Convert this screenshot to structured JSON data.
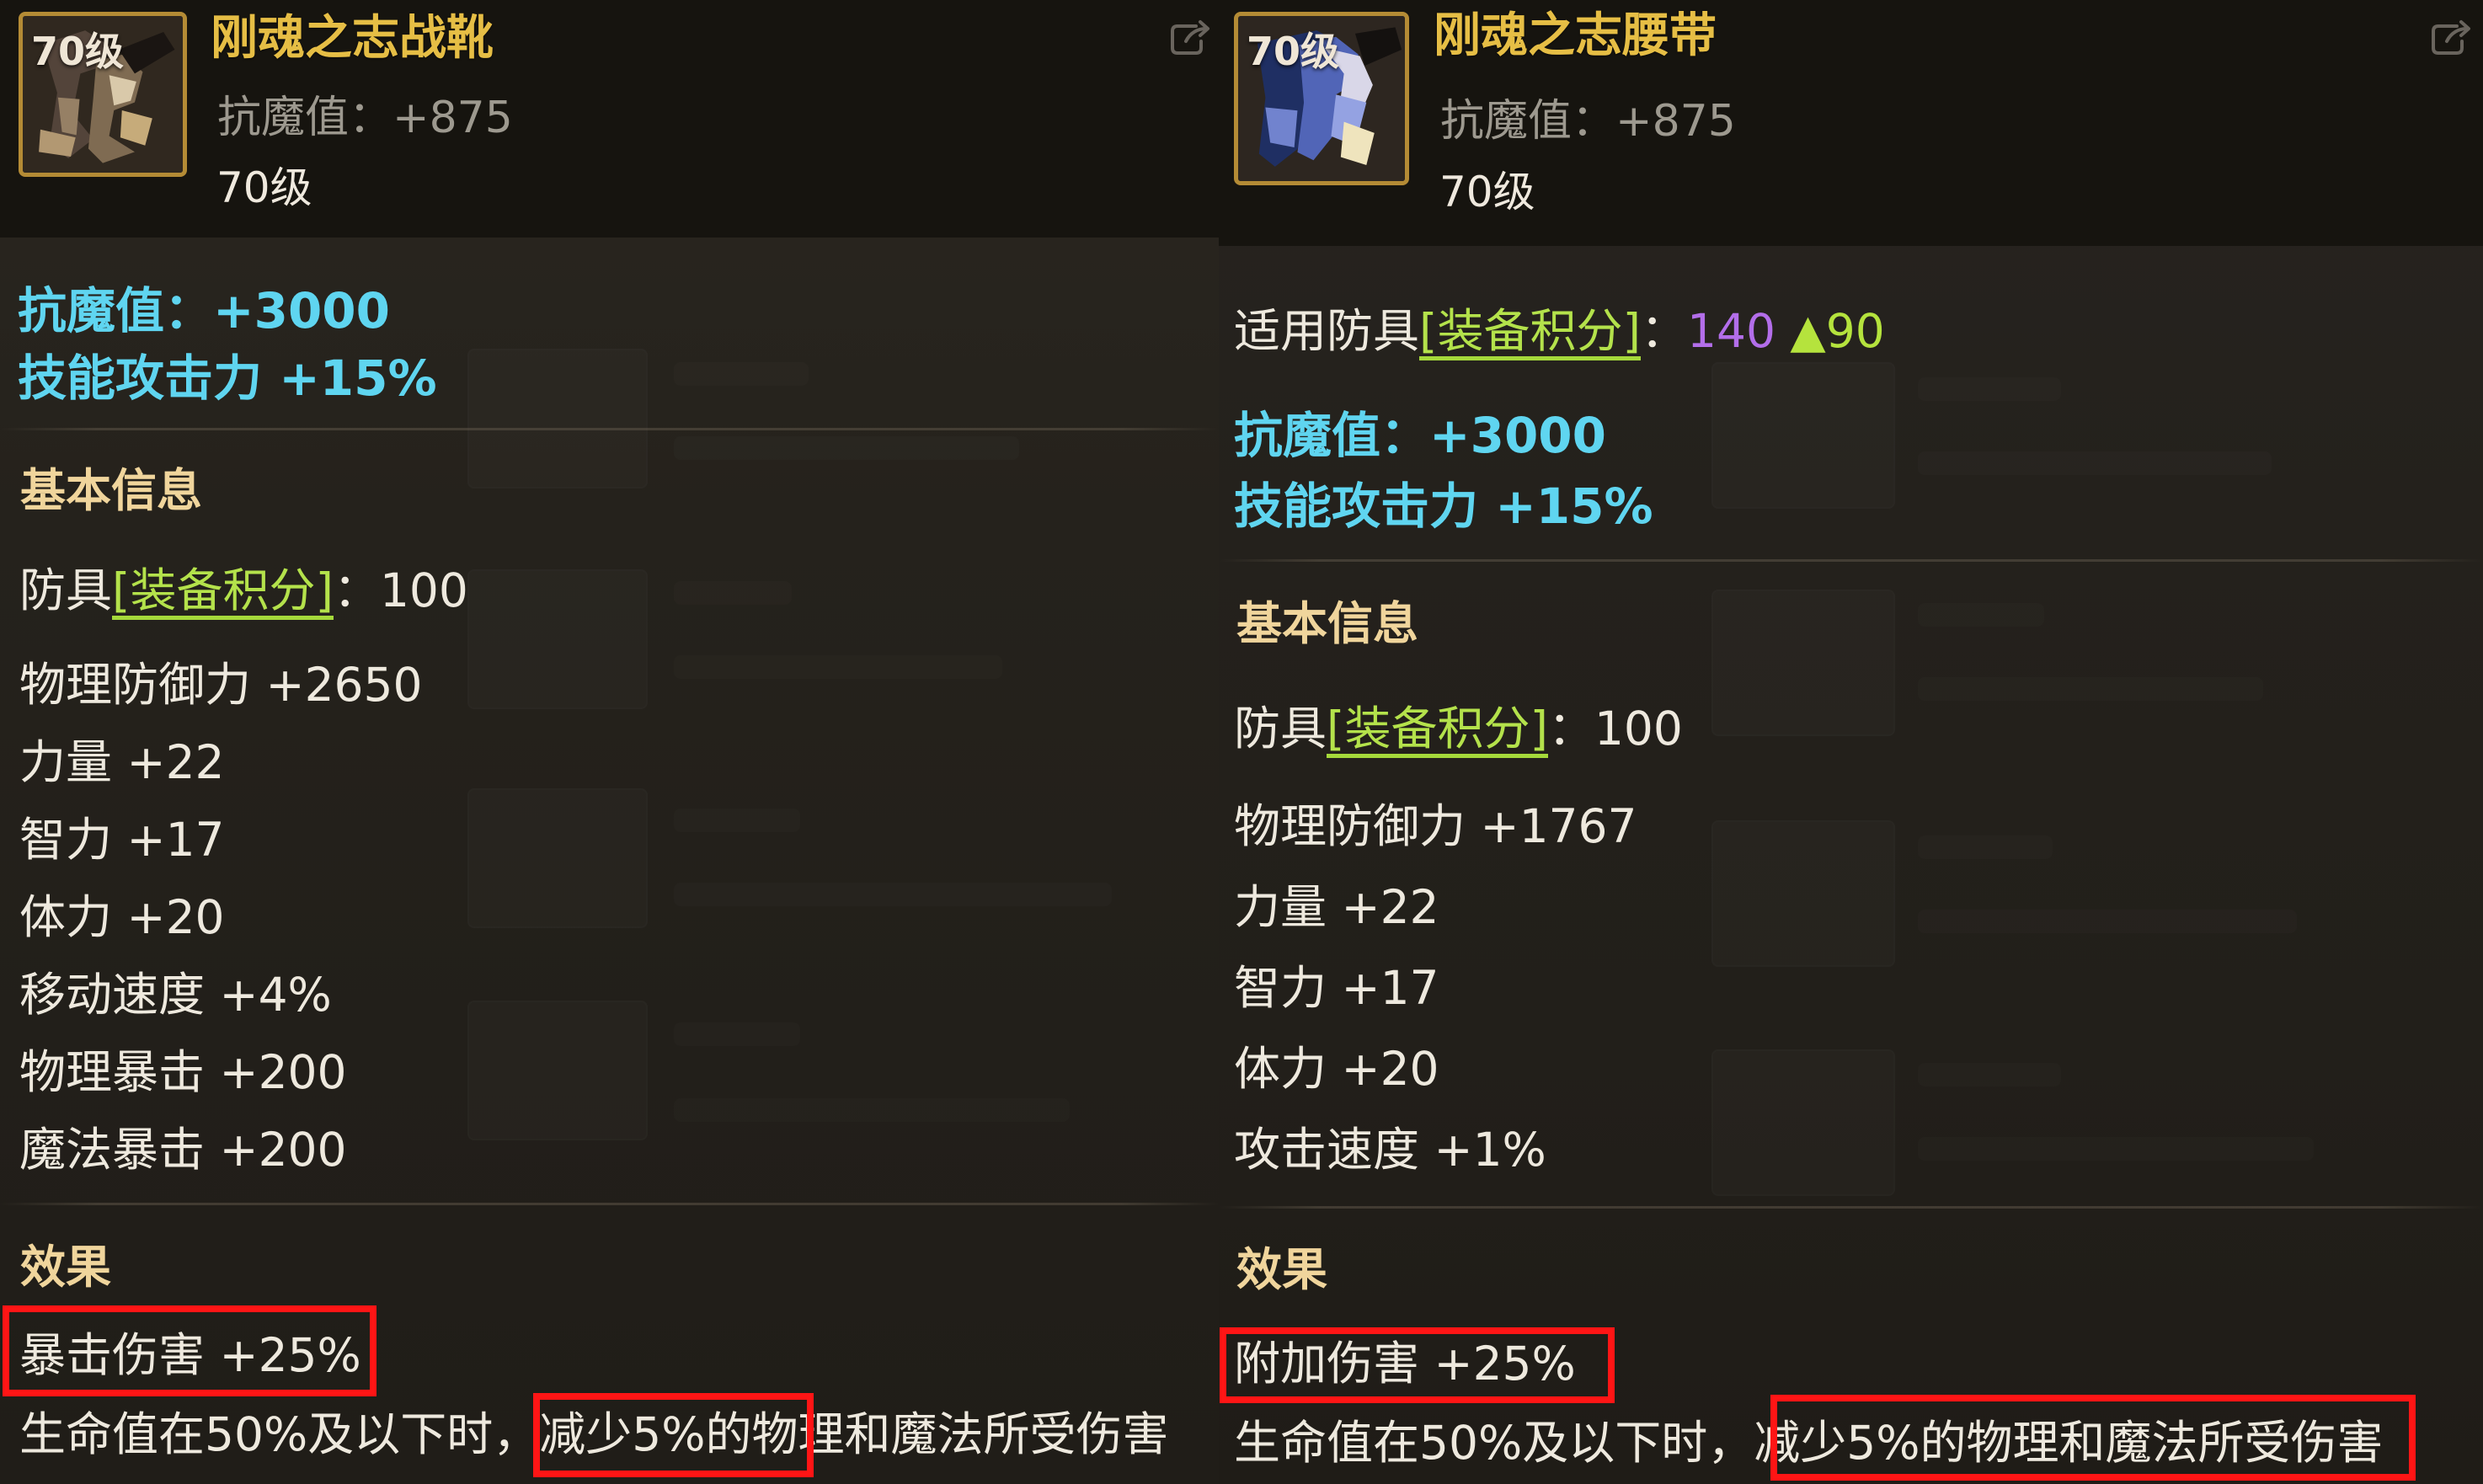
{
  "left": {
    "icon_name": "boots-icon",
    "badge": "70级",
    "title": "刚魂之志战靴",
    "sub_label": "抗魔值：",
    "sub_value": "+875",
    "level": "70级",
    "bonus": [
      "抗魔值：+3000",
      "技能攻击力 +15%"
    ],
    "basic_heading": "基本信息",
    "score": {
      "prefix": "防具",
      "link": "[装备积分]",
      "suffix": "：100"
    },
    "stats": [
      "物理防御力 +2650",
      "力量 +22",
      "智力 +17",
      "体力 +20",
      "移动速度 +4%",
      "物理暴击 +200",
      "魔法暴击 +200"
    ],
    "effects_heading": "效果",
    "effects": [
      "暴击伤害 +25%",
      "生命值在50%及以下时，减少5%的物理和魔法所受伤害"
    ]
  },
  "right": {
    "icon_name": "belt-icon",
    "badge": "70级",
    "title": "刚魂之志腰带",
    "sub_label": "抗魔值：",
    "sub_value": "+875",
    "level": "70级",
    "applicable": {
      "prefix": "适用防具",
      "link": "[装备积分]",
      "colon": "：",
      "value": "140",
      "delta": "▲90"
    },
    "bonus": [
      "抗魔值：+3000",
      "技能攻击力 +15%"
    ],
    "basic_heading": "基本信息",
    "score": {
      "prefix": "防具",
      "link": "[装备积分]",
      "suffix": "：100"
    },
    "stats": [
      "物理防御力 +1767",
      "力量 +22",
      "智力 +17",
      "体力 +20",
      "攻击速度 +1%"
    ],
    "effects_heading": "效果",
    "effects": [
      "附加伤害 +25%",
      "生命值在50%及以下时，减少5%的物理和魔法所受伤害"
    ]
  },
  "colors": {
    "title": "#e6be45",
    "cyan": "#5fd5f0",
    "section": "#f0d59c",
    "green_link": "#b4e24b",
    "purple": "#b36eea",
    "highlight_red": "#ff1515"
  }
}
